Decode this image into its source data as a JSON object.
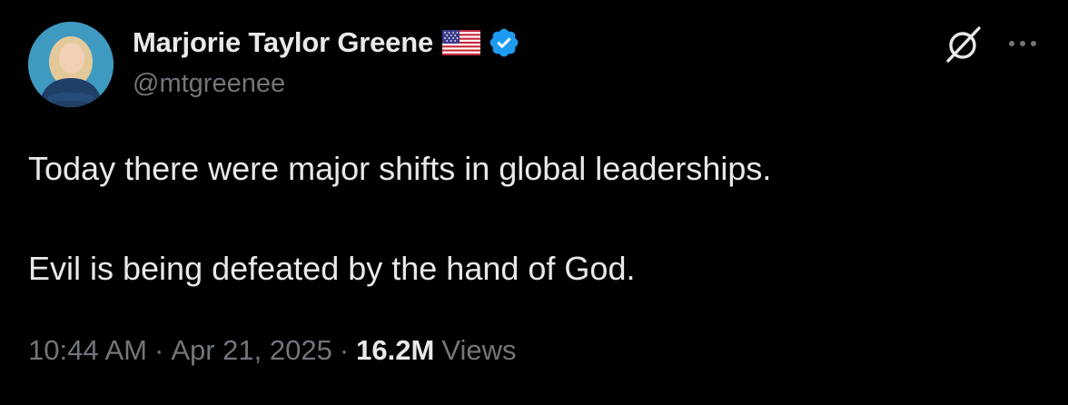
{
  "author": {
    "display_name": "Marjorie Taylor Greene",
    "handle": "@mtgreenee",
    "badges": [
      "us-flag-icon",
      "verified-icon"
    ],
    "verified_color": "#1d9bf0"
  },
  "actions": {
    "grok_icon": "grok-icon",
    "more_icon": "more-options-icon"
  },
  "tweet": {
    "paragraphs": [
      "Today there were major shifts in global leaderships.",
      "Evil is being defeated by the hand of God."
    ]
  },
  "meta": {
    "time": "10:44 AM",
    "separator": "·",
    "date": "Apr 21, 2025",
    "views_count": "16.2M",
    "views_label": "Views"
  },
  "colors": {
    "background": "#000000",
    "primary_text": "#e7e9ea",
    "secondary_text": "#71767b"
  }
}
